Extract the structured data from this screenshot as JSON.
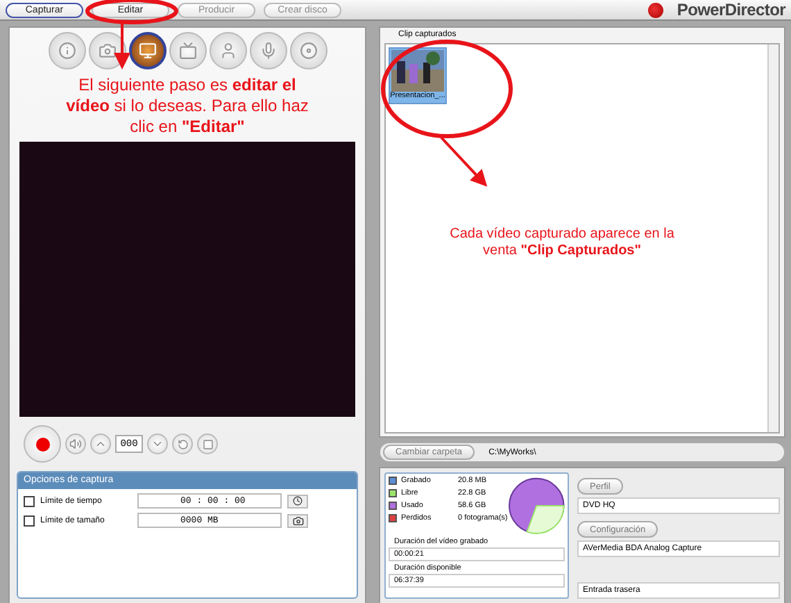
{
  "tabs": [
    {
      "label": "Capturar",
      "selected": true,
      "disabled": false
    },
    {
      "label": "Editar",
      "selected": false,
      "disabled": false
    },
    {
      "label": "Producir",
      "selected": false,
      "disabled": true
    },
    {
      "label": "Crear disco",
      "selected": false,
      "disabled": true
    }
  ],
  "logo": "PowerDirector",
  "tools": [
    {
      "kind": "info",
      "selected": false
    },
    {
      "kind": "camera",
      "selected": false
    },
    {
      "kind": "monitor",
      "selected": true
    },
    {
      "kind": "tv",
      "selected": false
    },
    {
      "kind": "user",
      "selected": false
    },
    {
      "kind": "mic",
      "selected": false
    },
    {
      "kind": "disc",
      "selected": false
    }
  ],
  "annotations": [
    {
      "text": "El siguiente paso es **editar el vídeo** si lo deseas. Para ello haz clic en **\"Editar\"**"
    },
    {
      "text": "Cada vídeo capturado aparece en la venta **\"Clip Capturados\"**"
    }
  ],
  "counter": "000",
  "capture_options": {
    "title": "Opciones de captura",
    "rows": [
      {
        "label": "Límite de tiempo",
        "checked": false,
        "value": "00 : 00 : 00"
      },
      {
        "label": "Límite de tamaño",
        "checked": false,
        "value": "0000  MB"
      }
    ]
  },
  "clips": {
    "title": "Clip capturados",
    "items": [
      {
        "label": "Presentacion_...",
        "selected": true
      }
    ]
  },
  "folder": {
    "button": "Cambiar carpeta",
    "path": "C:\\MyWorks\\"
  },
  "legend": [
    {
      "label": "Grabado",
      "value": "20.8  MB",
      "color": "#5b8fd8"
    },
    {
      "label": "Libre",
      "value": "22.8  GB",
      "color": "#9be46a"
    },
    {
      "label": "Usado",
      "value": "58.6  GB",
      "color": "#b070e0"
    },
    {
      "label": "Perdidos",
      "value": "0 fotograma(s)",
      "color": "#e04040"
    }
  ],
  "durations": [
    {
      "label": "Duración del vídeo grabado",
      "value": "00:00:21"
    },
    {
      "label": "Duración disponible",
      "value": "06:37:39"
    }
  ],
  "settings": [
    {
      "button": "Perfil",
      "value": "DVD HQ"
    },
    {
      "button": "Configuración",
      "value": "AVerMedia BDA Analog Capture"
    },
    {
      "value": "Entrada trasera"
    }
  ]
}
